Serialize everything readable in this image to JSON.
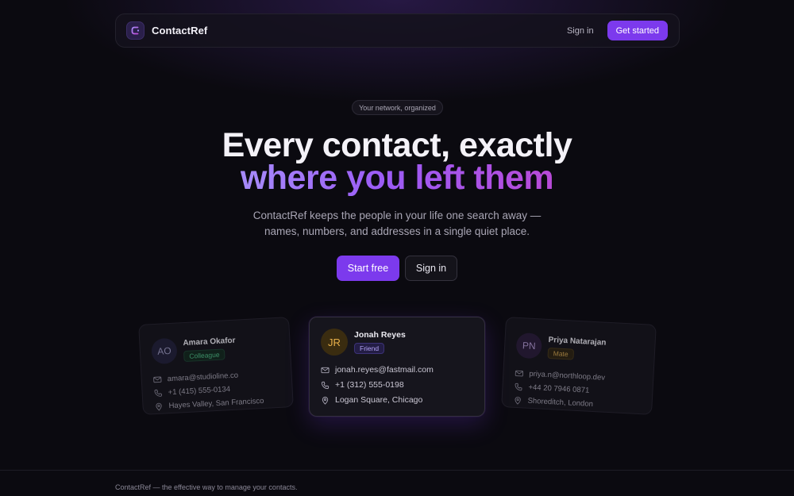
{
  "nav": {
    "brand": "ContactRef",
    "sign_in": "Sign in",
    "get_started": "Get started"
  },
  "hero": {
    "pill": "Your network, organized",
    "title_line1": "Every contact, exactly",
    "title_line2": "where you left them",
    "subtitle_line1": "ContactRef keeps the people in your life one search away —",
    "subtitle_line2": "names, numbers, and addresses in a single quiet place.",
    "start_free": "Start free",
    "sign_in": "Sign in"
  },
  "cards": [
    {
      "initials": "AO",
      "name": "Amara Okafor",
      "tag": "Colleague",
      "email": "amara@studioline.co",
      "phone": "+1 (415) 555-0134",
      "address": "Hayes Valley, San Francisco"
    },
    {
      "initials": "JR",
      "name": "Jonah Reyes",
      "tag": "Friend",
      "email": "jonah.reyes@fastmail.com",
      "phone": "+1 (312) 555-0198",
      "address": "Logan Square, Chicago"
    },
    {
      "initials": "PN",
      "name": "Priya Natarajan",
      "tag": "Mate",
      "email": "priya.n@northloop.dev",
      "phone": "+44 20 7946 0871",
      "address": "Shoreditch, London"
    }
  ],
  "footer": {
    "text": "ContactRef — the effective way to manage your contacts."
  },
  "colors": {
    "accent": "#7c3aed",
    "background": "#0b0a10"
  },
  "icons": [
    "logo-icon",
    "mail-icon",
    "phone-icon",
    "location-pin-icon"
  ]
}
